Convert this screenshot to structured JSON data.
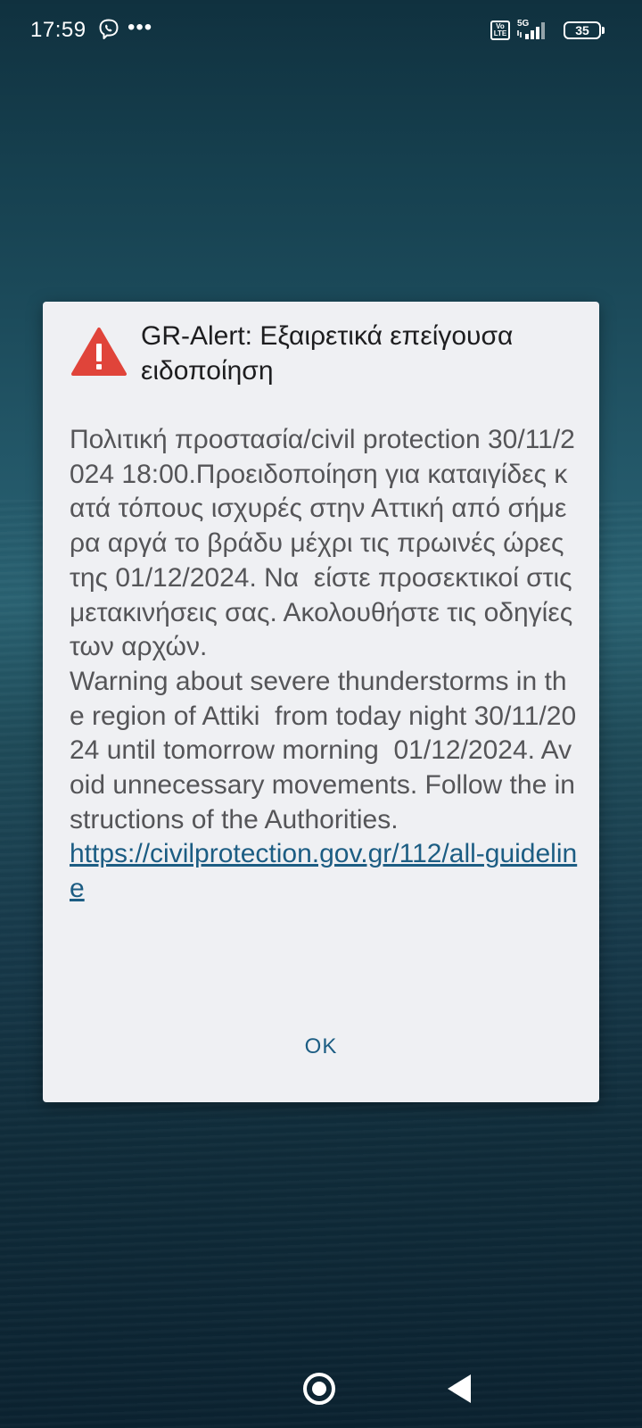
{
  "status_bar": {
    "time": "17:59",
    "notification_icons": [
      "viber-icon",
      "more-icon"
    ],
    "more_label": "•••",
    "volte_label": "Vo LTE",
    "network_type": "5G",
    "battery_level": "35"
  },
  "dialog": {
    "icon": "warning-triangle-icon",
    "icon_color": "#e0443a",
    "title": "GR-Alert: Εξαιρετικά επείγουσα ειδοποίηση",
    "message": "Πολιτική προστασία/civil protection 30/11/2024 18:00.Προειδοποίηση για καταιγίδες κατά τόπους ισχυρές στην Αττική από σήμερα αργά το βράδυ μέχρι τις πρωινές ώρες της 01/12/2024. Να  είστε προσεκτικοί στις μετακινήσεις σας. Ακολουθήστε τις οδηγίες των αρχών.\nWarning about severe thunderstorms in the region of Attiki  from today night 30/11/2024 until tomorrow morning  01/12/2024. Avoid unnecessary movements. Follow the instructions of the Authorities.\n",
    "link": "https://civilprotection.gov.gr/112/all-guideline",
    "ok_label": "OK",
    "accent_color": "#1c5d83"
  },
  "nav_bar": {
    "buttons": [
      "home-button",
      "back-button"
    ]
  }
}
